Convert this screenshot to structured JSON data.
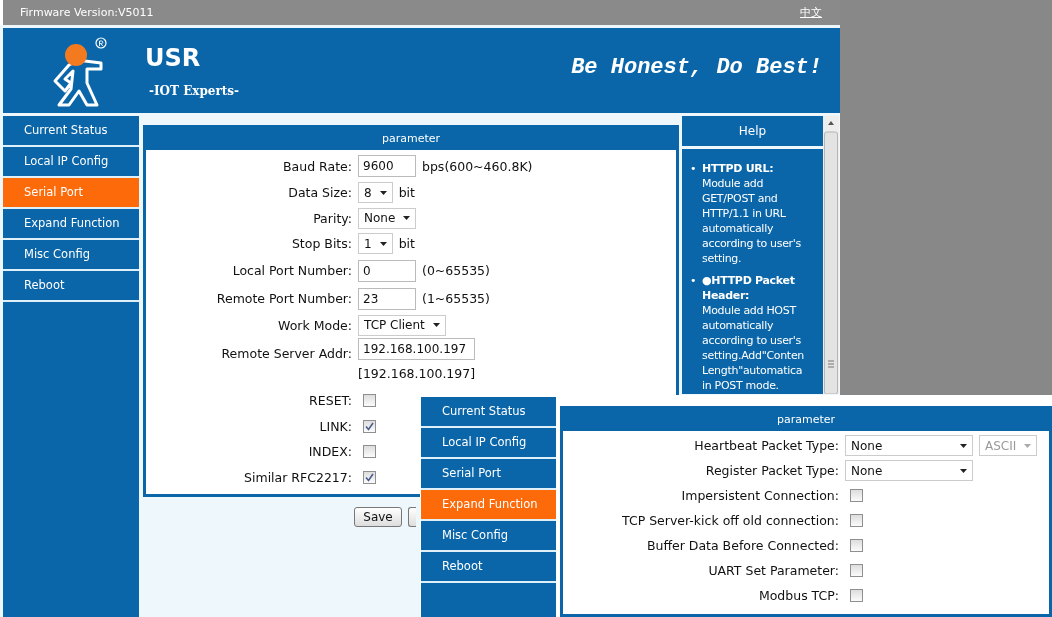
{
  "top_bar": {
    "firmware": "Firmware Version:V5011",
    "language_link": "中文"
  },
  "header": {
    "brand": "USR",
    "tagline": "-IOT Experts-",
    "slogan": "Be Honest, Do Best!"
  },
  "sidebar": {
    "items": [
      {
        "label": "Current Status",
        "selected": false
      },
      {
        "label": "Local IP Config",
        "selected": false
      },
      {
        "label": "Serial Port",
        "selected": true
      },
      {
        "label": "Expand Function",
        "selected": false
      },
      {
        "label": "Misc Config",
        "selected": false
      },
      {
        "label": "Reboot",
        "selected": false
      }
    ]
  },
  "serial_panel": {
    "title": "parameter",
    "rows": [
      {
        "kind": "input",
        "label": "Baud Rate:",
        "value": "9600",
        "hint": "bps(600~460.8K)"
      },
      {
        "kind": "select",
        "label": "Data Size:",
        "value": "8",
        "unit": "bit"
      },
      {
        "kind": "select",
        "label": "Parity:",
        "value": "None"
      },
      {
        "kind": "select",
        "label": "Stop Bits:",
        "value": "1",
        "unit": "bit"
      },
      {
        "kind": "input",
        "label": "Local Port Number:",
        "value": "0",
        "hint": "(0~65535)"
      },
      {
        "kind": "input",
        "label": "Remote Port Number:",
        "value": "23",
        "hint": "(1~65535)"
      },
      {
        "kind": "select",
        "label": "Work Mode:",
        "value": "TCP Client"
      },
      {
        "kind": "input",
        "label": "Remote Server Addr:",
        "value": "192.168.100.197",
        "note": "[192.168.100.197]"
      },
      {
        "kind": "checkbox",
        "label": "RESET:",
        "checked": false
      },
      {
        "kind": "checkbox",
        "label": "LINK:",
        "checked": true
      },
      {
        "kind": "checkbox",
        "label": "INDEX:",
        "checked": false
      },
      {
        "kind": "checkbox",
        "label": "Similar RFC2217:",
        "checked": true
      }
    ]
  },
  "buttons": [
    "Save"
  ],
  "help": {
    "title": "Help",
    "items": [
      {
        "marker": "•",
        "title": [
          "HTTPD URL:"
        ],
        "lines": [
          "Module add",
          "GET/POST and",
          "HTTP/1.1 in URL",
          "automatically",
          "according to user's",
          "setting."
        ]
      },
      {
        "marker": "•",
        "title": [
          "●HTTPD Packet",
          "Header:"
        ],
        "lines": [
          "Module add HOST",
          "automatically",
          "according to user's",
          "setting.Add\"Conten",
          "Length\"automatica",
          "in POST mode."
        ]
      }
    ]
  },
  "overlay": {
    "sidebar": {
      "items": [
        {
          "label": "Current Status",
          "selected": false
        },
        {
          "label": "Local IP Config",
          "selected": false
        },
        {
          "label": "Serial Port",
          "selected": false
        },
        {
          "label": "Expand Function",
          "selected": true
        },
        {
          "label": "Misc Config",
          "selected": false
        },
        {
          "label": "Reboot",
          "selected": false
        }
      ]
    },
    "panel": {
      "title": "parameter",
      "rows": [
        {
          "kind": "select",
          "label": "Heartbeat Packet Type:",
          "value": "None",
          "extra": {
            "value": "ASCII",
            "disabled": true
          }
        },
        {
          "kind": "select",
          "label": "Register Packet Type:",
          "value": "None"
        },
        {
          "kind": "checkbox",
          "label": "Impersistent Connection:",
          "checked": false
        },
        {
          "kind": "checkbox",
          "label": "TCP Server-kick off old connection:",
          "checked": false
        },
        {
          "kind": "checkbox",
          "label": "Buffer Data Before Connected:",
          "checked": false
        },
        {
          "kind": "checkbox",
          "label": "UART Set Parameter:",
          "checked": false
        },
        {
          "kind": "checkbox",
          "label": "Modbus TCP:",
          "checked": false
        }
      ]
    }
  }
}
